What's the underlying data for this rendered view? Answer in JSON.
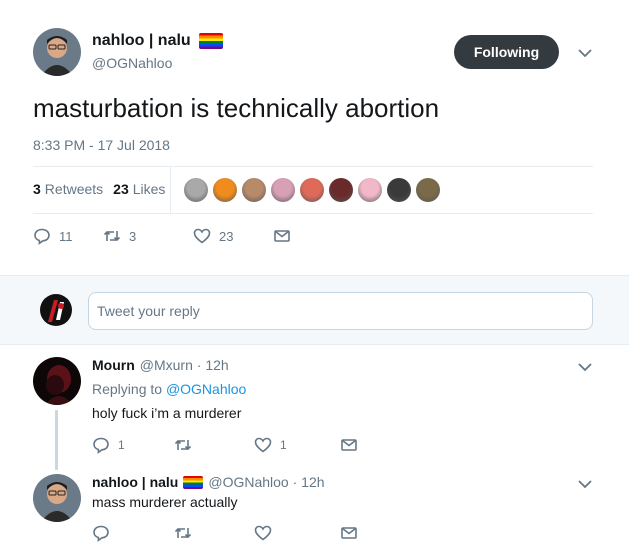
{
  "tweet": {
    "display_name": "nahloo | nalu",
    "flag_icon": "rainbow-flag-icon",
    "handle": "@OGNahloo",
    "follow_label": "Following",
    "text": "masturbation is technically abortion",
    "timestamp": "8:33 PM - 17 Jul 2018",
    "stats": {
      "retweets_count": "3",
      "retweets_label": "Retweets",
      "likes_count": "23",
      "likes_label": "Likes"
    },
    "actions": {
      "reply_count": "11",
      "retweet_count": "3",
      "like_count": "23"
    },
    "liker_colors": [
      "#a9a9a9",
      "#f08c1e",
      "#b78a6a",
      "#d8a0b5",
      "#e06a5a",
      "#6a2a2a",
      "#f0b8c8",
      "#3a3a3a",
      "#7a6a4a"
    ]
  },
  "reply_box": {
    "placeholder": "Tweet your reply"
  },
  "replies": [
    {
      "display_name": "Mourn",
      "meta": "@Mxurn · 12h",
      "replying_prefix": "Replying to",
      "replying_to": "@OGNahloo",
      "text": "holy fuck i’m a murderer",
      "reply_count": "1",
      "retweet_count": "",
      "like_count": "1"
    },
    {
      "display_name": "nahloo | nalu",
      "meta": "@OGNahloo · 12h",
      "text": "mass murderer actually",
      "reply_count": "",
      "retweet_count": "",
      "like_count": ""
    }
  ]
}
